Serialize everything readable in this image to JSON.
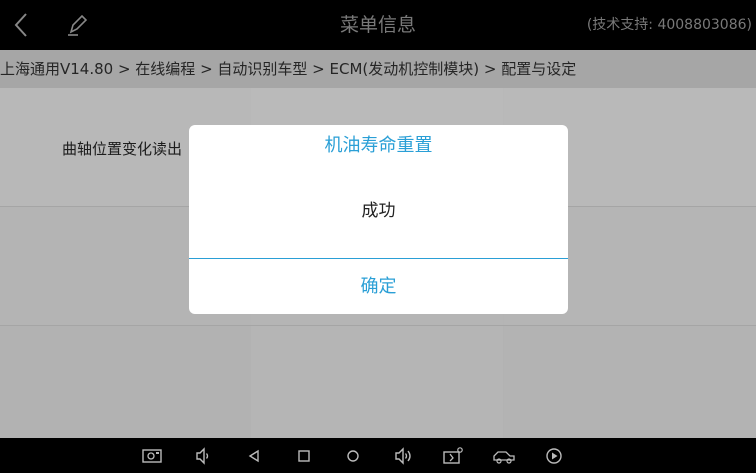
{
  "header": {
    "title": "菜单信息",
    "support_text": "(技术支持: 4008803086)",
    "back_icon": "chevron-left-icon",
    "edit_icon": "pencil-icon"
  },
  "breadcrumb": {
    "text": "上海通用V14.80 > 在线编程 > 自动识别车型 > ECM(发动机控制模块) > 配置与设定"
  },
  "menu": {
    "items": [
      {
        "label": "曲轴位置变化读出"
      }
    ]
  },
  "dialog": {
    "title": "机油寿命重置",
    "message": "成功",
    "confirm_label": "确定"
  },
  "navbar": {
    "icons": [
      "screenshot-icon",
      "volume-down-icon",
      "back-icon",
      "recent-apps-icon",
      "home-icon",
      "volume-up-icon",
      "vci-icon",
      "vehicle-icon",
      "play-icon"
    ]
  },
  "colors": {
    "accent": "#2a9fd6",
    "topbar_bg": "#000000",
    "breadcrumb_bg": "#bdbdbd"
  }
}
